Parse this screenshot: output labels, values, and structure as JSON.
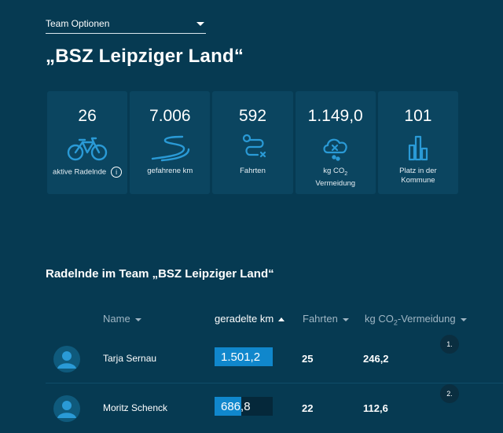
{
  "team_select": {
    "label": "Team Optionen"
  },
  "team_title": "„BSZ Leipziger Land“",
  "stats": [
    {
      "value": "26",
      "label": "aktive Radelnde",
      "icon": "bicycle-icon"
    },
    {
      "value": "7.006",
      "label": "gefahrene km",
      "icon": "road-icon"
    },
    {
      "value": "592",
      "label": "Fahrten",
      "icon": "route-icon"
    },
    {
      "value": "1.149,0",
      "label_line1": "kg CO",
      "label_sub": "2",
      "label_line2": "Vermeidung",
      "icon": "co2-cloud-icon"
    },
    {
      "value": "101",
      "label_line1": "Platz in der",
      "label_line2": "Kommune",
      "icon": "bar-chart-icon"
    }
  ],
  "info_icon_glyph": "i",
  "section_title": "Radelnde im Team „BSZ Leipziger Land“",
  "table": {
    "headers": {
      "name": "Name",
      "km": "geradelte km",
      "rides": "Fahrten",
      "co2_prefix": "kg CO",
      "co2_sub": "2",
      "co2_suffix": "-Vermeidung"
    },
    "rows": [
      {
        "rank": "1.",
        "name": "Tarja Sernau",
        "km": "1.501,2",
        "km_fraction": 1.0,
        "rides": "25",
        "co2": "246,2"
      },
      {
        "rank": "2.",
        "name": "Moritz Schenck",
        "km": "686,8",
        "km_fraction": 0.457,
        "rides": "22",
        "co2": "112,6"
      }
    ]
  },
  "colors": {
    "background": "#063a52",
    "card": "#0b4560",
    "accent": "#1087cc",
    "icon": "#2a9ad6"
  }
}
